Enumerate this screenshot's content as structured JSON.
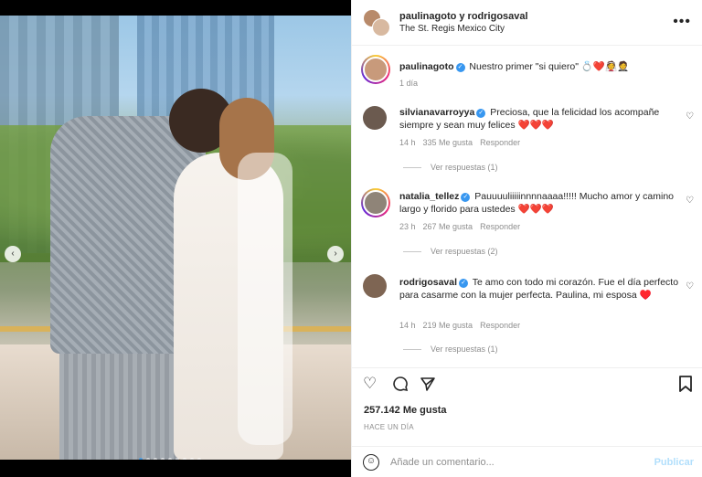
{
  "header": {
    "users": "paulinagoto y rodrigosaval",
    "location": "The St. Regis Mexico City",
    "more_icon": "more-horizontal-icon"
  },
  "caption": {
    "username": "paulinagoto",
    "text": "Nuestro primer \"si quiero\" 💍❤️👰🤵",
    "time": "1 día"
  },
  "comments": [
    {
      "username": "silvianavarroyya",
      "text": "Preciosa, que la felicidad los acompañe siempre y sean muy felices ❤️❤️❤️",
      "time": "14 h",
      "likes": "335 Me gusta",
      "reply": "Responder",
      "view_replies": "Ver respuestas (1)"
    },
    {
      "username": "natalia_tellez",
      "text": "Pauuuuliiiiinnnnaaaa!!!!! Mucho amor y camino largo y florido para ustedes ❤️❤️❤️",
      "time": "23 h",
      "likes": "267 Me gusta",
      "reply": "Responder",
      "view_replies": "Ver respuestas (2)"
    },
    {
      "username": "rodrigosaval",
      "text": "Te amo con todo mi corazón. Fue el día perfecto para casarme con la mujer perfecta. Paulina, mi esposa ♥️",
      "time": "14 h",
      "likes": "219 Me gusta",
      "reply": "Responder",
      "view_replies": "Ver respuestas (1)"
    }
  ],
  "post": {
    "likes": "257.142 Me gusta",
    "time_ago": "HACE UN DÍA"
  },
  "composer": {
    "placeholder": "Añade un comentario...",
    "post_label": "Publicar"
  },
  "carousel": {
    "slide_count": 9,
    "active_index": 0
  },
  "colors": {
    "verified": "#3897f0",
    "muted": "#8e8e8e",
    "post_button": "#b2dffc"
  }
}
